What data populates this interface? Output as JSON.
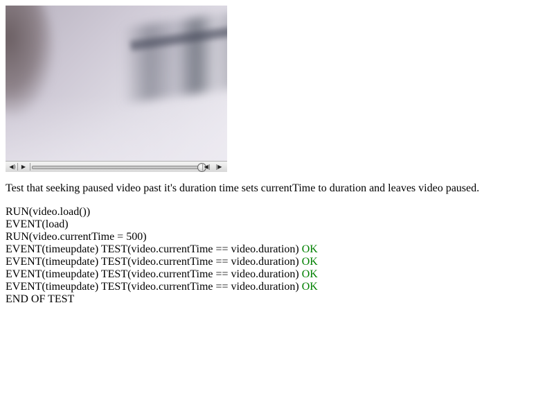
{
  "video": {
    "controls": {
      "mute_icon": "volume-icon",
      "play_icon": "play-icon",
      "seek_back_icon": "seek-back-icon",
      "seek_forward_icon": "seek-forward-icon",
      "progress": 1.0
    }
  },
  "description": "Test that seeking paused video past it's duration time sets currentTime to duration and leaves video paused.",
  "log": [
    {
      "text": "RUN(video.load())",
      "result": ""
    },
    {
      "text": "EVENT(load)",
      "result": ""
    },
    {
      "text": "RUN(video.currentTime = 500)",
      "result": ""
    },
    {
      "text": "EVENT(timeupdate) TEST(video.currentTime == video.duration)",
      "result": "OK"
    },
    {
      "text": "EVENT(timeupdate) TEST(video.currentTime == video.duration)",
      "result": "OK"
    },
    {
      "text": "EVENT(timeupdate) TEST(video.currentTime == video.duration)",
      "result": "OK"
    },
    {
      "text": "EVENT(timeupdate) TEST(video.currentTime == video.duration)",
      "result": "OK"
    },
    {
      "text": "END OF TEST",
      "result": ""
    }
  ],
  "colors": {
    "ok": "#008000"
  }
}
